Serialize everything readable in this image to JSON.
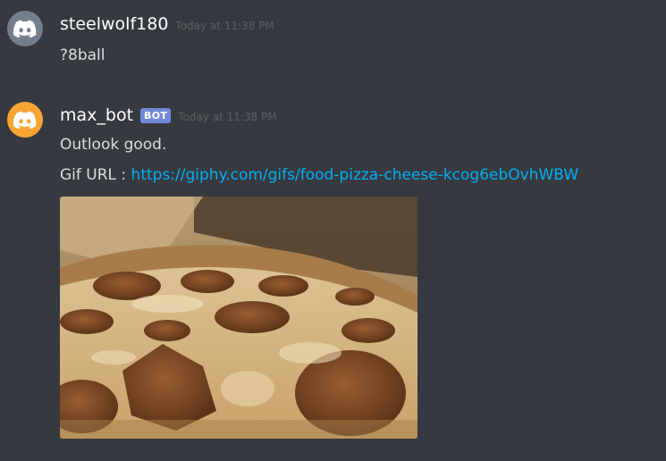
{
  "messages": [
    {
      "author": "steelwolf180",
      "timestamp": "Today at 11:38 PM",
      "avatar_icon": "discord-logo-icon",
      "avatar_color": "#747f8d",
      "lines": [
        "?8ball"
      ]
    },
    {
      "author": "max_bot",
      "bot_tag": "BOT",
      "timestamp": "Today at 11:38 PM",
      "avatar_icon": "discord-logo-icon",
      "avatar_color": "#f8a532",
      "lines": [
        "Outlook good."
      ],
      "gif_prefix": "Gif URL : ",
      "gif_url": "https://giphy.com/gifs/food-pizza-cheese-kcog6ebOvhWBW",
      "embed": {
        "type": "gif",
        "subject": "pizza with pepperoni and cheese"
      }
    }
  ],
  "colors": {
    "background": "#36393f",
    "username": "#ffffff",
    "text": "#dcddde",
    "timestamp": "#5b5e63",
    "link": "#00b0f4",
    "bot_tag": "#7289da"
  }
}
